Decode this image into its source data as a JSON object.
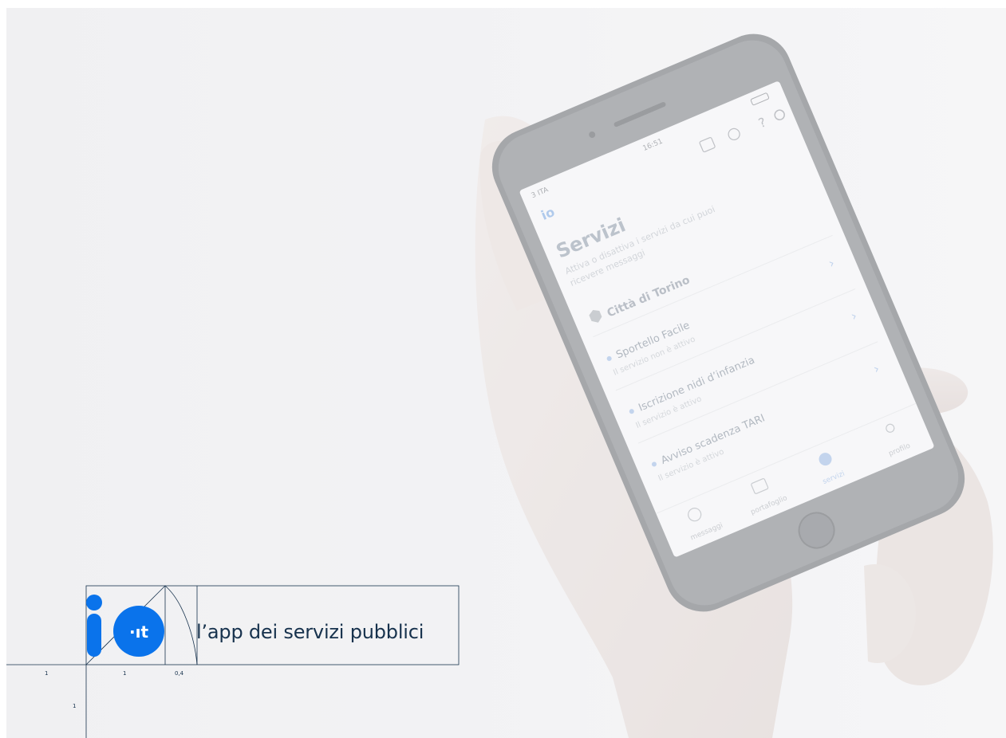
{
  "brand": {
    "logo_letter": "i",
    "logo_badge": "·ıt",
    "tagline": "l’app dei servizi pubblici",
    "accent": "#0a73eb",
    "text": "#17324d"
  },
  "construction": {
    "unit_label_1": "1",
    "unit_label_2": "1",
    "ratio_label": "0,4",
    "unit_label_vertical": "1"
  },
  "phone": {
    "carrier": "3 ITA",
    "time": "16:51",
    "app_logo": "io",
    "screen_title": "Servizi",
    "screen_subtitle_1": "Attiva o disattiva i servizi da cui puoi",
    "screen_subtitle_2": "ricevere messaggi",
    "entity": "Città di Torino",
    "services": [
      {
        "name": "Sportello Facile",
        "status": "Il servizio non è attivo"
      },
      {
        "name": "Iscrizione nidi d’infanzia",
        "status": "Il servizio è attivo"
      },
      {
        "name": "Avviso scadenza TARI",
        "status": "Il servizio è attivo"
      }
    ],
    "tabs": [
      "messaggi",
      "portafoglio",
      "servizi",
      "profilo"
    ]
  }
}
